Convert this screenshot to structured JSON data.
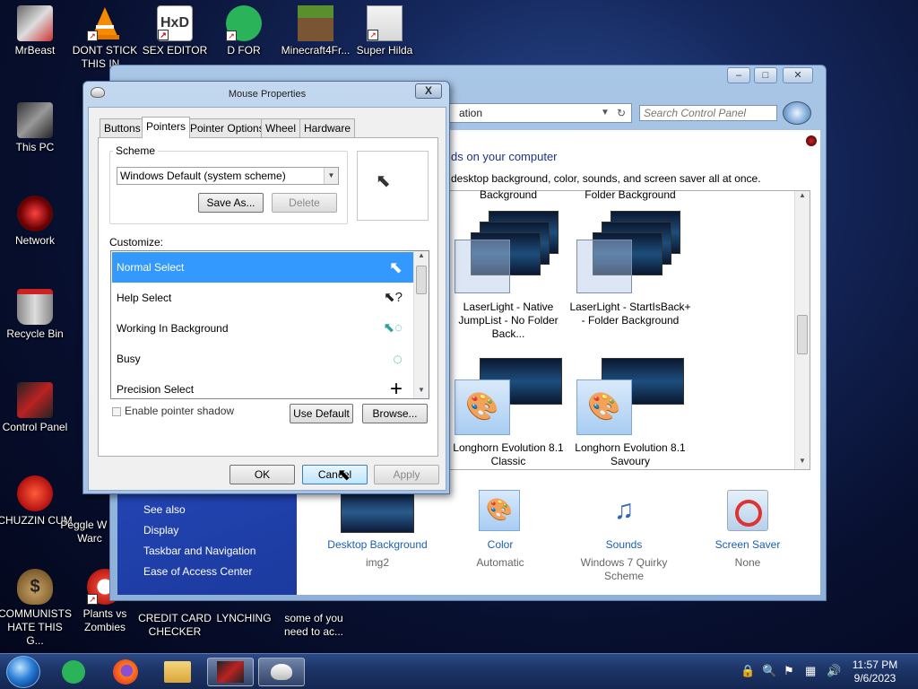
{
  "desktop": {
    "icons": [
      {
        "label": "MrBeast",
        "icon": "mrbeast-icon"
      },
      {
        "label": "DONT STICK THIS IN...",
        "icon": "vlc-icon"
      },
      {
        "label": "SEX EDITOR",
        "icon": "hex-editor-icon"
      },
      {
        "label": "D FOR",
        "icon": "green-app-icon"
      },
      {
        "label": "Minecraft4Fr...",
        "icon": "minecraft-icon"
      },
      {
        "label": "Super Hilda",
        "icon": "hilda-icon"
      },
      {
        "label": "This PC",
        "icon": "computer-icon"
      },
      {
        "label": "Network",
        "icon": "network-icon"
      },
      {
        "label": "Recycle Bin",
        "icon": "recycle-bin-icon"
      },
      {
        "label": "Control Panel",
        "icon": "control-panel-icon"
      },
      {
        "label": "CHUZZIN CUM",
        "icon": "chuzzle-icon"
      },
      {
        "label": "Peggle W of Warc",
        "icon": "peggle-icon"
      },
      {
        "label": "COMMUNISTS HATE THIS G...",
        "icon": "money-bag-icon"
      },
      {
        "label": "Plants vs Zombies",
        "icon": "pvz-icon"
      },
      {
        "label": "CREDIT CARD CHECKER",
        "icon": "app-icon"
      },
      {
        "label": "LYNCHING",
        "icon": "app-icon"
      },
      {
        "label": "some of you need to ac...",
        "icon": "app-icon"
      }
    ]
  },
  "control_panel": {
    "address": "ation",
    "search_placeholder": "Search Control Panel",
    "heading_fragment": "ds on your computer",
    "description_fragment": "desktop background, color, sounds, and screen saver all at once.",
    "themes": [
      {
        "top_label": "Background",
        "label": "LaserLight - Native JumpList - No Folder Back..."
      },
      {
        "top_label": "Folder Background",
        "label": "LaserLight - StartIsBack+ - Folder Background"
      },
      {
        "label": "Longhorn Evolution 8.1 Classic"
      },
      {
        "label": "Longhorn Evolution 8.1 Savoury"
      }
    ],
    "see_also": {
      "title": "See also",
      "links": [
        "Display",
        "Taskbar and Navigation",
        "Ease of Access Center"
      ]
    },
    "bottom_items": [
      {
        "title": "Desktop Background",
        "sub": "img2"
      },
      {
        "title": "Color",
        "sub": "Automatic"
      },
      {
        "title": "Sounds",
        "sub": "Windows 7 Quirky Scheme"
      },
      {
        "title": "Screen Saver",
        "sub": "None"
      }
    ]
  },
  "dialog": {
    "title": "Mouse Properties",
    "close": "X",
    "tabs": [
      "Buttons",
      "Pointers",
      "Pointer Options",
      "Wheel",
      "Hardware"
    ],
    "active_tab": "Pointers",
    "scheme_label": "Scheme",
    "scheme_value": "Windows Default (system scheme)",
    "save_as": "Save As...",
    "delete": "Delete",
    "customize_label": "Customize:",
    "pointers": [
      {
        "name": "Normal Select",
        "glyph": "⬉"
      },
      {
        "name": "Help Select",
        "glyph": "⬉?"
      },
      {
        "name": "Working In Background",
        "glyph": "⬉◌"
      },
      {
        "name": "Busy",
        "glyph": "◌"
      },
      {
        "name": "Precision Select",
        "glyph": "+"
      }
    ],
    "shadow_label": "Enable pointer shadow",
    "use_default": "Use Default",
    "browse": "Browse...",
    "ok": "OK",
    "cancel": "Cancel",
    "apply": "Apply"
  },
  "taskbar": {
    "time": "11:57 PM",
    "date": "9/6/2023"
  }
}
